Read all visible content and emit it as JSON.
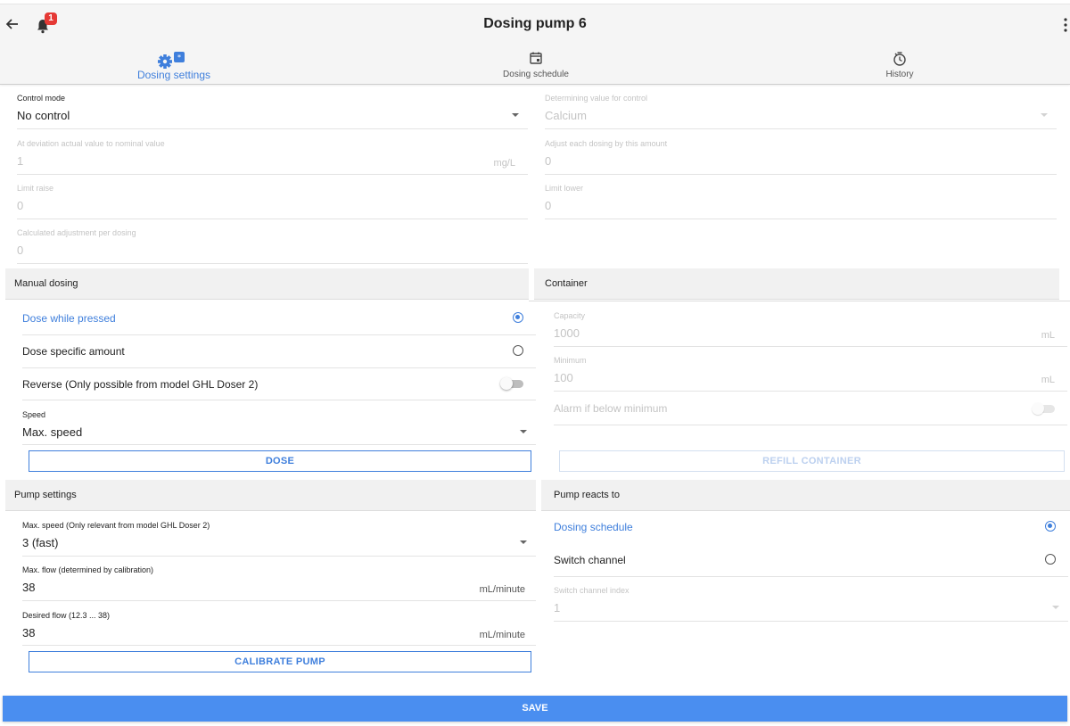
{
  "header": {
    "title": "Dosing pump 6",
    "notification_count": "1"
  },
  "tabs": [
    {
      "label": "Dosing settings",
      "icon": "gear-icon",
      "active": true
    },
    {
      "label": "Dosing schedule",
      "icon": "calendar-icon",
      "active": false
    },
    {
      "label": "History",
      "icon": "history-icon",
      "active": false
    }
  ],
  "control": {
    "control_mode": {
      "label": "Control mode",
      "value": "No control"
    },
    "determining_value": {
      "label": "Determining value for control",
      "value": "Calcium"
    },
    "deviation": {
      "label": "At deviation actual value to nominal value",
      "value": "1",
      "unit": "mg/L"
    },
    "adjust_each": {
      "label": "Adjust each dosing by this amount",
      "value": "0"
    },
    "limit_raise": {
      "label": "Limit raise",
      "value": "0"
    },
    "limit_lower": {
      "label": "Limit lower",
      "value": "0"
    },
    "calculated": {
      "label": "Calculated adjustment per dosing",
      "value": "0"
    }
  },
  "manual": {
    "title": "Manual dosing",
    "dose_while_pressed": "Dose while pressed",
    "dose_specific": "Dose specific amount",
    "reverse": "Reverse (Only possible from model GHL Doser 2)",
    "speed": {
      "label": "Speed",
      "value": "Max. speed"
    },
    "dose_button": "DOSE"
  },
  "container": {
    "title": "Container",
    "capacity": {
      "label": "Capacity",
      "value": "1000",
      "unit": "mL"
    },
    "minimum": {
      "label": "Minimum",
      "value": "100",
      "unit": "mL"
    },
    "alarm": "Alarm if below minimum",
    "refill_button": "REFILL CONTAINER"
  },
  "pump_settings": {
    "title": "Pump settings",
    "max_speed": {
      "label": "Max. speed (Only relevant from model GHL Doser 2)",
      "value": "3 (fast)"
    },
    "max_flow": {
      "label": "Max. flow (determined by calibration)",
      "value": "38",
      "unit": "mL/minute"
    },
    "desired_flow": {
      "label": "Desired flow (12.3 ... 38)",
      "value": "38",
      "unit": "mL/minute"
    },
    "calibrate_button": "CALIBRATE PUMP"
  },
  "reacts": {
    "title": "Pump reacts to",
    "dosing_schedule": "Dosing schedule",
    "switch_channel": "Switch channel",
    "switch_index": {
      "label": "Switch channel index",
      "value": "1"
    }
  },
  "save_label": "SAVE",
  "colors": {
    "accent": "#3f7fdc",
    "save_bar": "#4a8ef0",
    "badge": "#e53935"
  }
}
